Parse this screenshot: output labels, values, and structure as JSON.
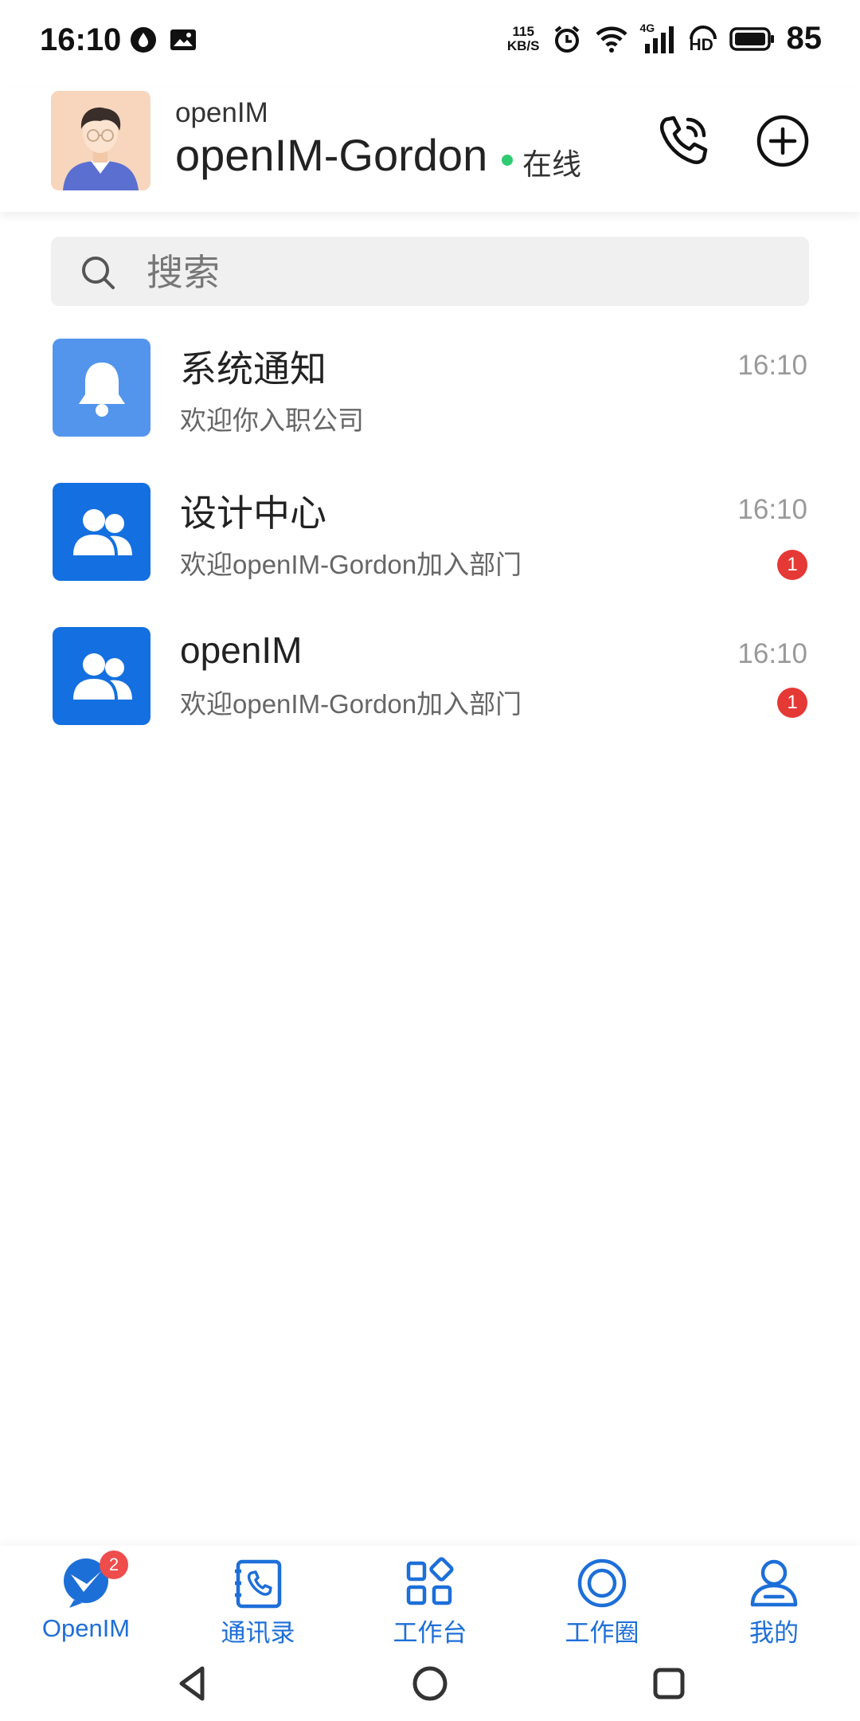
{
  "status_bar": {
    "time": "16:10",
    "net_speed_value": "115",
    "net_speed_unit": "KB/S",
    "network_type": "4G",
    "hd_label": "HD",
    "battery": "85"
  },
  "header": {
    "org_name": "openIM",
    "user_name": "openIM-Gordon",
    "status_text": "在线",
    "status_color": "#2ecc71"
  },
  "search": {
    "placeholder": "搜索"
  },
  "conversations": [
    {
      "title": "系统通知",
      "subtitle": "欢迎你入职公司",
      "time": "16:10",
      "icon": "bell-icon",
      "color": "#5395ec"
    },
    {
      "title": "设计中心",
      "subtitle": "欢迎openIM-Gordon加入部门",
      "time": "16:10",
      "badge": "1",
      "icon": "group-icon",
      "color": "#1470e0"
    },
    {
      "title": "openIM",
      "subtitle": "欢迎openIM-Gordon加入部门",
      "time": "16:10",
      "badge": "1",
      "icon": "group-icon",
      "color": "#1470e0"
    }
  ],
  "bottom_nav": {
    "tabs": [
      {
        "label": "OpenIM",
        "icon": "chat-logo-icon",
        "badge": "2",
        "active": true
      },
      {
        "label": "通讯录",
        "icon": "contacts-icon"
      },
      {
        "label": "工作台",
        "icon": "workbench-icon"
      },
      {
        "label": "工作圈",
        "icon": "moments-icon"
      },
      {
        "label": "我的",
        "icon": "profile-icon"
      }
    ],
    "accent_color": "#1d6fd8",
    "badge_color": "#ef4c4c"
  }
}
